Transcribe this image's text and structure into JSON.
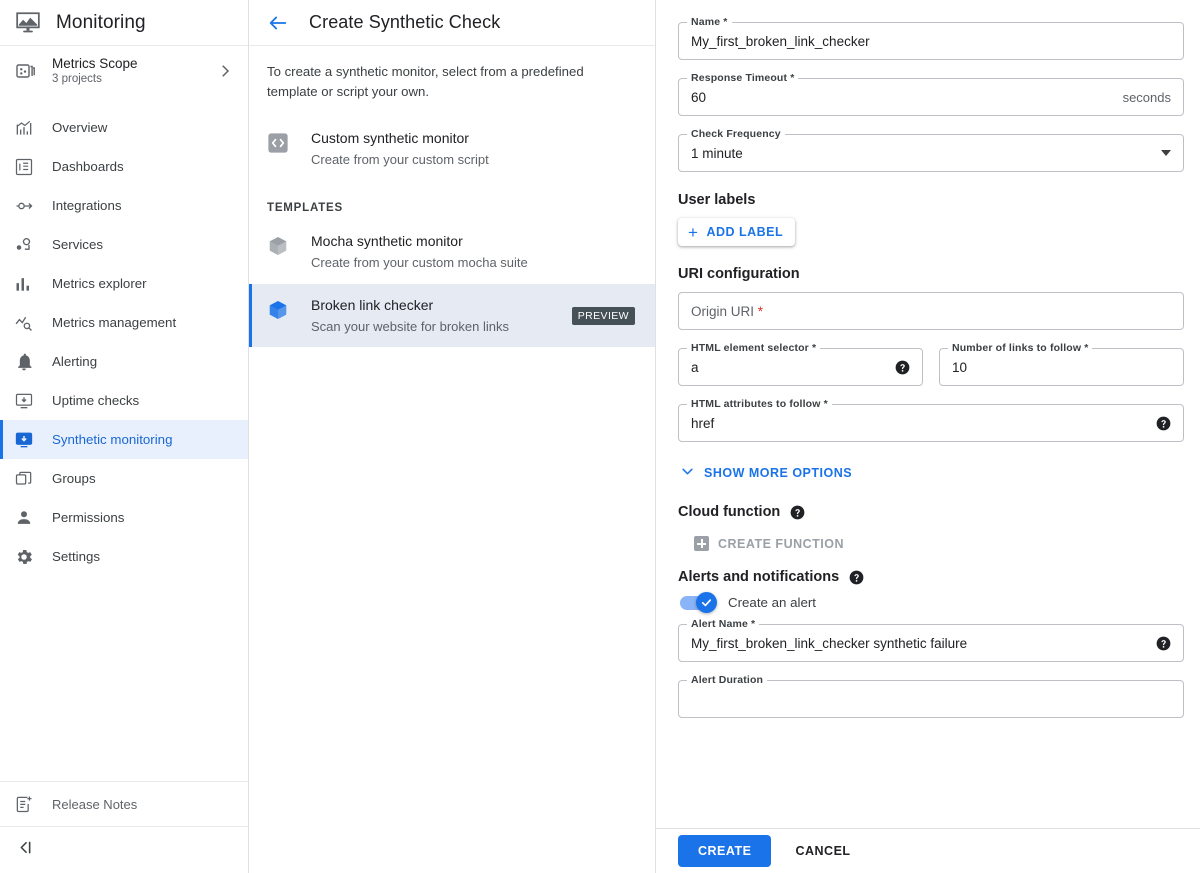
{
  "sidebar": {
    "brand": {
      "title": "Monitoring",
      "icon": "monitor-chart-icon"
    },
    "scope": {
      "title": "Metrics Scope",
      "subtitle": "3 projects",
      "icon": "metrics-scope-icon",
      "chevron": "chevron-right-icon"
    },
    "items": [
      {
        "label": "Overview",
        "icon": "overview-chart-icon",
        "active": false
      },
      {
        "label": "Dashboards",
        "icon": "dashboards-icon",
        "active": false
      },
      {
        "label": "Integrations",
        "icon": "integrations-icon",
        "active": false
      },
      {
        "label": "Services",
        "icon": "services-icon",
        "active": false
      },
      {
        "label": "Metrics explorer",
        "icon": "bar-chart-icon",
        "active": false
      },
      {
        "label": "Metrics management",
        "icon": "metrics-management-icon",
        "active": false
      },
      {
        "label": "Alerting",
        "icon": "bell-icon",
        "active": false
      },
      {
        "label": "Uptime checks",
        "icon": "uptime-monitor-icon",
        "active": false
      },
      {
        "label": "Synthetic monitoring",
        "icon": "synthetic-monitor-icon",
        "active": true
      },
      {
        "label": "Groups",
        "icon": "groups-icon",
        "active": false
      },
      {
        "label": "Permissions",
        "icon": "person-icon",
        "active": false
      },
      {
        "label": "Settings",
        "icon": "gear-icon",
        "active": false
      }
    ],
    "release_notes": {
      "label": "Release Notes",
      "icon": "release-notes-icon"
    },
    "collapse": {
      "icon": "collapse-panel-icon"
    }
  },
  "middle": {
    "back_icon": "arrow-back-icon",
    "title": "Create Synthetic Check",
    "description": "To create a synthetic monitor, select from a predefined template or script your own.",
    "custom": {
      "title": "Custom synthetic monitor",
      "subtitle": "Create from your custom script",
      "icon": "code-brackets-icon"
    },
    "templates_label": "TEMPLATES",
    "templates": [
      {
        "title": "Mocha synthetic monitor",
        "subtitle": "Create from your custom mocha suite",
        "icon": "cube-icon",
        "selected": false,
        "badge": ""
      },
      {
        "title": "Broken link checker",
        "subtitle": "Scan your website for broken links",
        "icon": "cube-icon",
        "selected": true,
        "badge": "PREVIEW"
      }
    ]
  },
  "form": {
    "name": {
      "legend": "Name *",
      "value": "My_first_broken_link_checker"
    },
    "response_timeout": {
      "legend": "Response Timeout *",
      "value": "60",
      "suffix": "seconds"
    },
    "check_frequency": {
      "legend": "Check Frequency",
      "value": "1 minute",
      "icon": "chevron-down-icon"
    },
    "user_labels": {
      "heading": "User labels",
      "add_label_button": "ADD LABEL",
      "plus": "+"
    },
    "uri_configuration": {
      "heading": "URI configuration",
      "origin_uri": {
        "placeholder": "Origin URI",
        "required_mark": "*",
        "value": ""
      },
      "html_element_selector": {
        "legend": "HTML element selector *",
        "value": "a",
        "help_icon": "help-icon"
      },
      "number_of_links": {
        "legend": "Number of links to follow *",
        "value": "10"
      },
      "html_attributes": {
        "legend": "HTML attributes to follow *",
        "value": "href",
        "help_icon": "help-icon"
      },
      "show_more": {
        "label": "SHOW MORE OPTIONS",
        "icon": "chevron-down-icon"
      }
    },
    "cloud_function": {
      "heading": "Cloud function",
      "help_icon": "help-icon",
      "create_function_button": "CREATE FUNCTION"
    },
    "alerts": {
      "heading": "Alerts and notifications",
      "help_icon": "help-icon",
      "toggle_label": "Create an alert",
      "toggle_on": true,
      "alert_name": {
        "legend": "Alert Name *",
        "value": "My_first_broken_link_checker synthetic failure",
        "help_icon": "help-icon"
      },
      "alert_duration": {
        "legend": "Alert Duration",
        "value": ""
      }
    }
  },
  "actions": {
    "create": "CREATE",
    "cancel": "CANCEL"
  },
  "colors": {
    "accent": "#1a73e8",
    "accent_light": "#8ab4f8",
    "selected_nav_bg": "#e8f0fe",
    "selected_tmpl_bg": "#e5eaf3",
    "badge_bg": "#455157",
    "muted_text": "#5f6368",
    "required_star": "#d93025"
  }
}
